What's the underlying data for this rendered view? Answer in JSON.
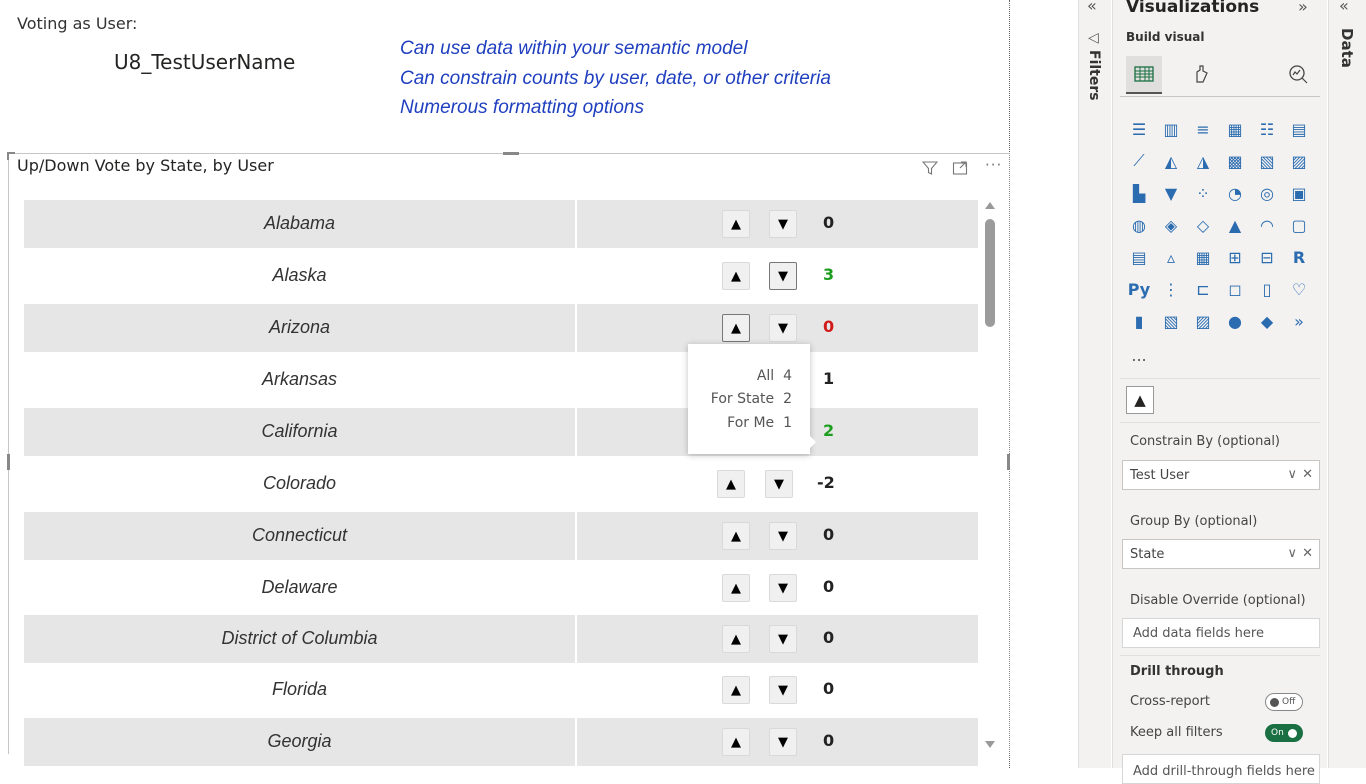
{
  "report": {
    "voting_label": "Voting as User:",
    "user_name": "U8_TestUserName",
    "notes": [
      "Can use data within your semantic model",
      "Can constrain counts by user, date, or other criteria",
      "Numerous formatting options"
    ]
  },
  "visual": {
    "title": "Up/Down Vote by State, by User",
    "filter_icon": "funnel-icon",
    "focus_icon": "focus-mode-icon",
    "more_icon": "more-options-icon",
    "up_glyph": "▲",
    "down_glyph": "▼",
    "rows": [
      {
        "state": "Alabama",
        "count": "0",
        "status": "neutral"
      },
      {
        "state": "Alaska",
        "count": "3",
        "status": "positive"
      },
      {
        "state": "Arizona",
        "count": "0",
        "status": "negative"
      },
      {
        "state": "Arkansas",
        "count": "1",
        "status": "neutral"
      },
      {
        "state": "California",
        "count": "2",
        "status": "positive"
      },
      {
        "state": "Colorado",
        "count": "-2",
        "status": "neutral"
      },
      {
        "state": "Connecticut",
        "count": "0",
        "status": "neutral"
      },
      {
        "state": "Delaware",
        "count": "0",
        "status": "neutral"
      },
      {
        "state": "District of Columbia",
        "count": "0",
        "status": "neutral"
      },
      {
        "state": "Florida",
        "count": "0",
        "status": "neutral"
      },
      {
        "state": "Georgia",
        "count": "0",
        "status": "neutral"
      }
    ],
    "tooltip": {
      "rows": [
        {
          "label": "All",
          "value": "4"
        },
        {
          "label": "For State",
          "value": "2"
        },
        {
          "label": "For Me",
          "value": "1"
        }
      ]
    }
  },
  "panes": {
    "filters_label": "Filters",
    "visualizations_title": "Visualizations",
    "build_visual": "Build visual",
    "data_label": "Data",
    "more_visuals": "...",
    "wells": [
      {
        "label": "Constrain By (optional)",
        "value": "Test User"
      },
      {
        "label": "Group By (optional)",
        "value": "State"
      },
      {
        "label": "Disable Override (optional)",
        "placeholder": "Add data fields here"
      }
    ],
    "drill_through": {
      "heading": "Drill through",
      "cross_report": "Cross-report",
      "cross_report_state": "Off",
      "keep_all_filters": "Keep all filters",
      "keep_all_filters_state": "On",
      "drill_placeholder": "Add drill-through fields here"
    }
  },
  "colors": {
    "positive": "#1e9e1e",
    "negative": "#d11b1b",
    "note_text": "#1f3fbf",
    "toggle_on": "#1a6f43"
  }
}
